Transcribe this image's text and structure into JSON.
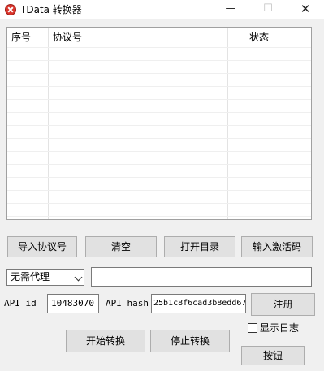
{
  "window": {
    "title": "TData 转换器",
    "minimize_glyph": "—",
    "maximize_glyph": "☐",
    "close_glyph": "✕"
  },
  "table": {
    "columns": [
      "序号",
      "协议号",
      "状态"
    ],
    "rows": []
  },
  "buttons": {
    "import": "导入协议号",
    "clear": "清空",
    "open_dir": "打开目录",
    "activation": "输入激活码",
    "register": "注册",
    "start": "开始转换",
    "stop": "停止转换",
    "generic": "按钮"
  },
  "proxy": {
    "selected": "无需代理",
    "address_value": ""
  },
  "api": {
    "id_label": "API_id",
    "id_value": "10483070",
    "hash_label": "API_hash",
    "hash_value": "25b1c8f6cad3b8edd67"
  },
  "log_checkbox": {
    "label": "显示日志",
    "checked": false
  },
  "colors": {
    "window_bg": "#f0f0f0",
    "button_bg": "#e1e1e1",
    "icon_red": "#d9342b"
  }
}
